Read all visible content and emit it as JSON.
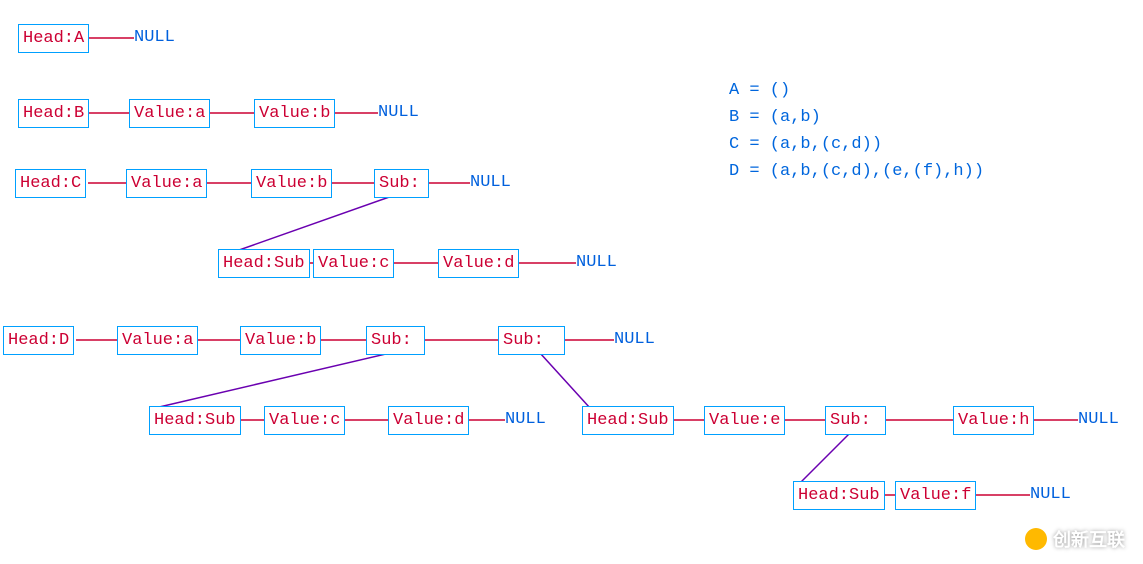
{
  "boxes": {
    "headA": "Head:A",
    "headB": "Head:B",
    "valueBa": "Value:a",
    "valueBb": "Value:b",
    "headC": "Head:C",
    "valueCa": "Value:a",
    "valueCb": "Value:b",
    "subC": "Sub:",
    "headCsub": "Head:Sub",
    "valueCc": "Value:c",
    "valueCd": "Value:d",
    "headD": "Head:D",
    "valueDa": "Value:a",
    "valueDb": "Value:b",
    "subD1": "Sub:",
    "subD2": "Sub:",
    "headDsub1": "Head:Sub",
    "valueDc": "Value:c",
    "valueDd": "Value:d",
    "headDsub2": "Head:Sub",
    "valueDe": "Value:e",
    "subD3": "Sub:",
    "valueDh": "Value:h",
    "headDsub3": "Head:Sub",
    "valueDf": "Value:f"
  },
  "nulls": {
    "nA": "NULL",
    "nB": "NULL",
    "nC": "NULL",
    "nCsub": "NULL",
    "nD": "NULL",
    "nDsub1": "NULL",
    "nDsub2": "NULL",
    "nDsub3": "NULL"
  },
  "legend": {
    "a": "A = ()",
    "b": "B = (a,b)",
    "c": "C = (a,b,(c,d))",
    "d": "D = (a,b,(c,d),(e,(f),h))"
  },
  "watermark": "创新互联",
  "chart_data": {
    "type": "diagram",
    "structure": "generalized-list-linked-nodes",
    "node_types": [
      "Head",
      "Value",
      "Sub"
    ],
    "terminal": "NULL",
    "definitions": [
      {
        "name": "A",
        "expr": "()"
      },
      {
        "name": "B",
        "expr": "(a,b)"
      },
      {
        "name": "C",
        "expr": "(a,b,(c,d))"
      },
      {
        "name": "D",
        "expr": "(a,b,(c,d),(e,(f),h))"
      }
    ],
    "lists": {
      "A": {
        "chain": [
          "Head:A",
          "NULL"
        ]
      },
      "B": {
        "chain": [
          "Head:B",
          "Value:a",
          "Value:b",
          "NULL"
        ]
      },
      "C": {
        "chain": [
          "Head:C",
          "Value:a",
          "Value:b",
          "Sub:",
          "NULL"
        ],
        "sublists": [
          {
            "from": "Sub:",
            "chain": [
              "Head:Sub",
              "Value:c",
              "Value:d",
              "NULL"
            ]
          }
        ]
      },
      "D": {
        "chain": [
          "Head:D",
          "Value:a",
          "Value:b",
          "Sub:",
          "Sub:",
          "NULL"
        ],
        "sublists": [
          {
            "from_index": 3,
            "chain": [
              "Head:Sub",
              "Value:c",
              "Value:d",
              "NULL"
            ]
          },
          {
            "from_index": 4,
            "chain": [
              "Head:Sub",
              "Value:e",
              "Sub:",
              "Value:h",
              "NULL"
            ],
            "sublists": [
              {
                "from": "Sub:",
                "chain": [
                  "Head:Sub",
                  "Value:f",
                  "NULL"
                ]
              }
            ]
          }
        ]
      }
    }
  }
}
